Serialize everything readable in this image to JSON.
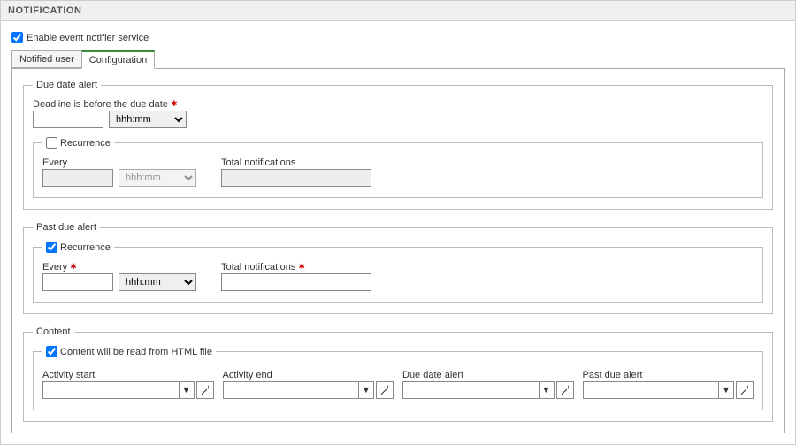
{
  "panel": {
    "title": "NOTIFICATION"
  },
  "enable": {
    "label": "Enable event notifier service",
    "checked": true
  },
  "tabs": {
    "notified_user": {
      "label": "Notified user"
    },
    "configuration": {
      "label": "Configuration"
    }
  },
  "due_date_alert": {
    "legend": "Due date alert",
    "deadline_label": "Deadline is before the due date",
    "deadline_value": "",
    "unit": "hhh:mm",
    "recurrence": {
      "legend": "Recurrence",
      "checked": false,
      "every_label": "Every",
      "every_value": "",
      "unit": "hhh:mm",
      "total_label": "Total notifications",
      "total_value": ""
    }
  },
  "past_due_alert": {
    "legend": "Past due alert",
    "recurrence": {
      "legend": "Recurrence",
      "checked": true,
      "every_label": "Every",
      "every_value": "",
      "unit": "hhh:mm",
      "total_label": "Total notifications",
      "total_value": ""
    }
  },
  "content": {
    "legend": "Content",
    "from_html": {
      "label": "Content will be read from HTML file",
      "checked": true
    },
    "activity_start": {
      "label": "Activity start",
      "value": ""
    },
    "activity_end": {
      "label": "Activity end",
      "value": ""
    },
    "due_date_alert": {
      "label": "Due date alert",
      "value": ""
    },
    "past_due_alert": {
      "label": "Past due alert",
      "value": ""
    }
  },
  "select_options": {
    "hhhmm": [
      "hhh:mm"
    ]
  }
}
